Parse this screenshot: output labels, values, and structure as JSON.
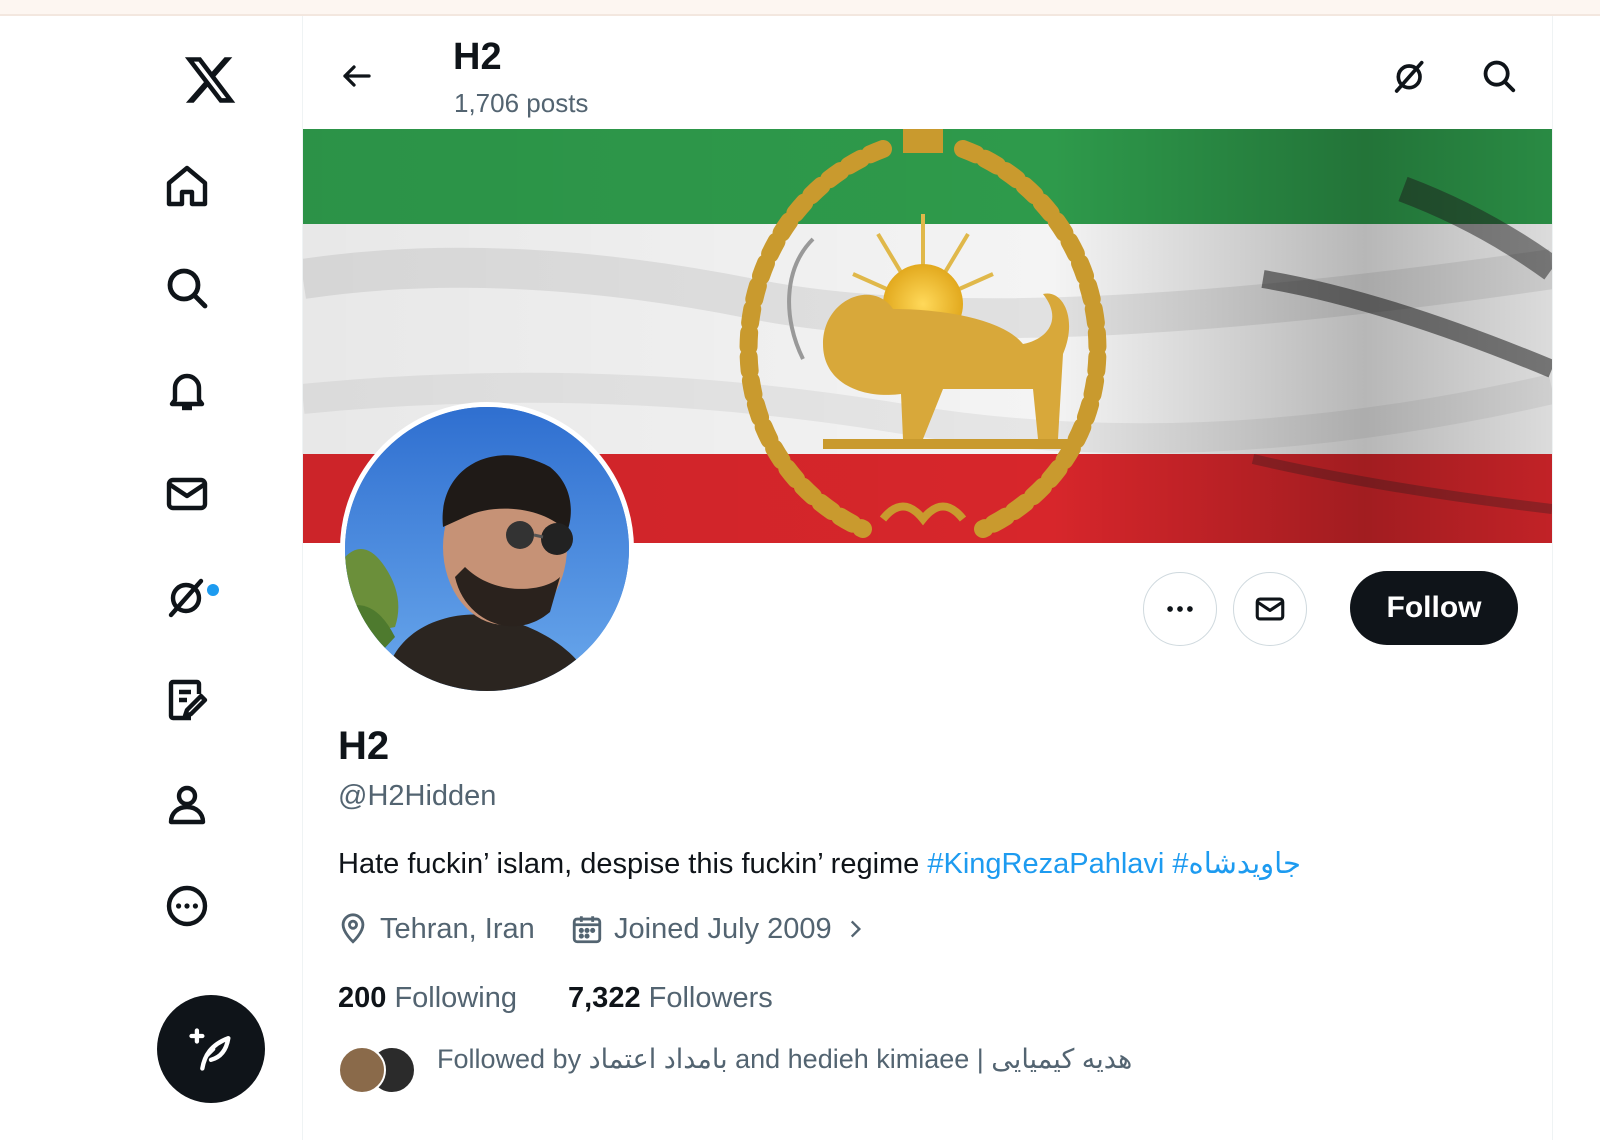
{
  "header": {
    "title": "H2",
    "posts_count": "1,706 posts"
  },
  "profile": {
    "display_name": "H2",
    "handle": "@H2Hidden",
    "bio_text": "Hate fuckin’ islam, despise this fuckin’ regime ",
    "bio_hashtags": "#KingRezaPahlavi #جاویدشاه",
    "location": "Tehran, Iran",
    "joined": "Joined July 2009",
    "following_count": "200",
    "following_label": "Following",
    "followers_count": "7,322",
    "followers_label": "Followers",
    "followed_by": "Followed by بامداد اعتماد and hedieh kimiaee | هدیه کیمیایی"
  },
  "actions": {
    "follow_label": "Follow",
    "more_label": "•••"
  },
  "icons": {
    "logo": "x-logo-icon",
    "nav": [
      "home-icon",
      "search-icon",
      "bell-icon",
      "mail-icon",
      "grok-icon",
      "notes-icon",
      "person-icon",
      "more-circle-icon"
    ],
    "compose": "compose-post-icon"
  },
  "colors": {
    "accent": "#1d9bf0",
    "text": "#0f1419",
    "secondary": "#536471",
    "flag_green": "#239f40",
    "flag_red": "#da0000"
  }
}
